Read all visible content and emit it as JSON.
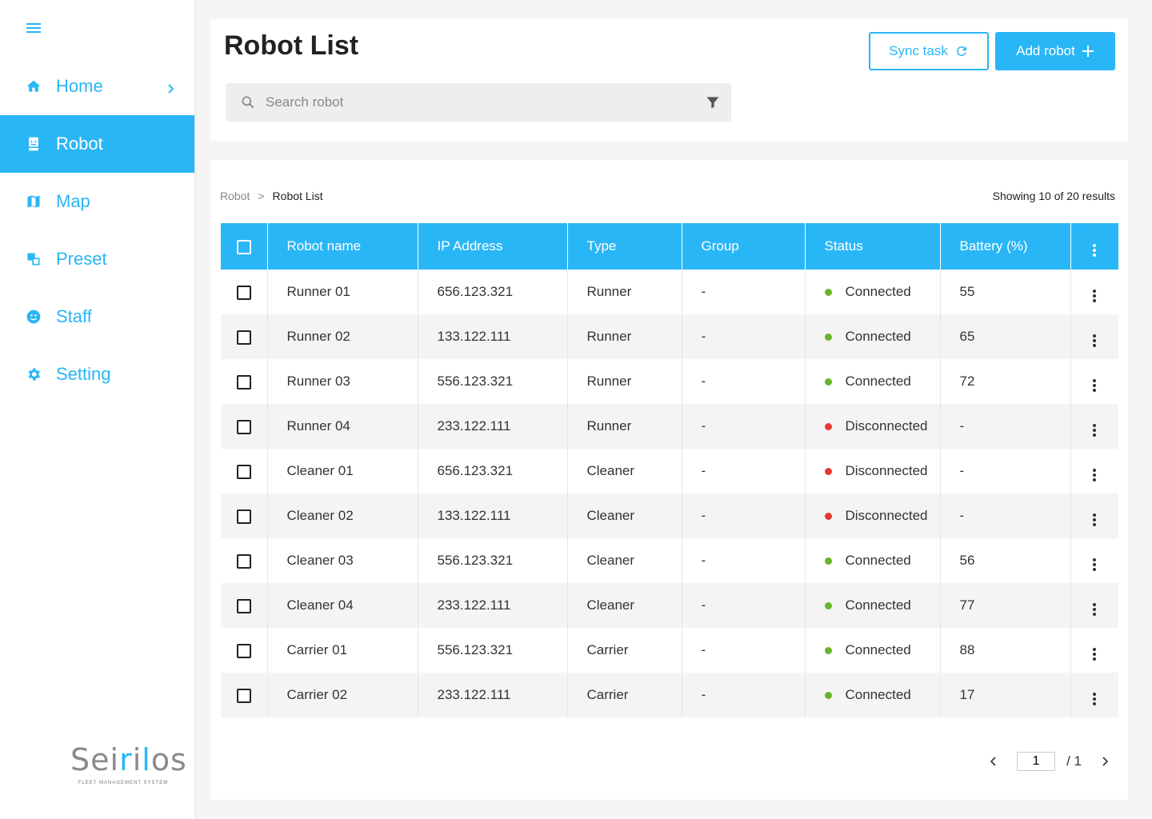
{
  "sidebar": {
    "items": [
      {
        "label": "Home",
        "icon": "home-icon",
        "active": false,
        "has_chevron": true
      },
      {
        "label": "Robot",
        "icon": "robot-icon",
        "active": true,
        "has_chevron": false
      },
      {
        "label": "Map",
        "icon": "map-icon",
        "active": false,
        "has_chevron": false
      },
      {
        "label": "Preset",
        "icon": "preset-icon",
        "active": false,
        "has_chevron": false
      },
      {
        "label": "Staff",
        "icon": "staff-icon",
        "active": false,
        "has_chevron": false
      },
      {
        "label": "Setting",
        "icon": "gear-icon",
        "active": false,
        "has_chevron": false
      }
    ],
    "logo": {
      "brand_pre": "Sei",
      "brand_hl1": "r",
      "brand_mid": "i",
      "brand_hl2": "l",
      "brand_post": "os",
      "tagline": "FLEET MANAGEMENT SYSTEM"
    }
  },
  "header": {
    "title": "Robot List",
    "sync_label": "Sync task",
    "add_label": "Add robot",
    "search_placeholder": "Search robot"
  },
  "content": {
    "breadcrumb": [
      "Robot",
      "Robot List"
    ],
    "results": "Showing 10 of 20 results",
    "columns": [
      "Robot name",
      "IP Address",
      "Type",
      "Group",
      "Status",
      "Battery (%)"
    ],
    "rows": [
      {
        "name": "Runner 01",
        "ip": "656.123.321",
        "type": "Runner",
        "group": "-",
        "status": "Connected",
        "battery": "55"
      },
      {
        "name": "Runner 02",
        "ip": "133.122.111",
        "type": "Runner",
        "group": "-",
        "status": "Connected",
        "battery": "65"
      },
      {
        "name": "Runner 03",
        "ip": "556.123.321",
        "type": "Runner",
        "group": "-",
        "status": "Connected",
        "battery": "72"
      },
      {
        "name": "Runner 04",
        "ip": "233.122.111",
        "type": "Runner",
        "group": "-",
        "status": "Disconnected",
        "battery": "-"
      },
      {
        "name": "Cleaner 01",
        "ip": "656.123.321",
        "type": "Cleaner",
        "group": "-",
        "status": "Disconnected",
        "battery": "-"
      },
      {
        "name": "Cleaner 02",
        "ip": "133.122.111",
        "type": "Cleaner",
        "group": "-",
        "status": "Disconnected",
        "battery": "-"
      },
      {
        "name": "Cleaner 03",
        "ip": "556.123.321",
        "type": "Cleaner",
        "group": "-",
        "status": "Connected",
        "battery": "56"
      },
      {
        "name": "Cleaner 04",
        "ip": "233.122.111",
        "type": "Cleaner",
        "group": "-",
        "status": "Connected",
        "battery": "77"
      },
      {
        "name": "Carrier 01",
        "ip": "556.123.321",
        "type": "Carrier",
        "group": "-",
        "status": "Connected",
        "battery": "88"
      },
      {
        "name": "Carrier 02",
        "ip": "233.122.111",
        "type": "Carrier",
        "group": "-",
        "status": "Connected",
        "battery": "17"
      }
    ],
    "pagination": {
      "current": "1",
      "total": "/ 1"
    }
  },
  "colors": {
    "accent": "#29b6f6",
    "connected": "#6ab42c",
    "disconnected": "#e53935"
  }
}
